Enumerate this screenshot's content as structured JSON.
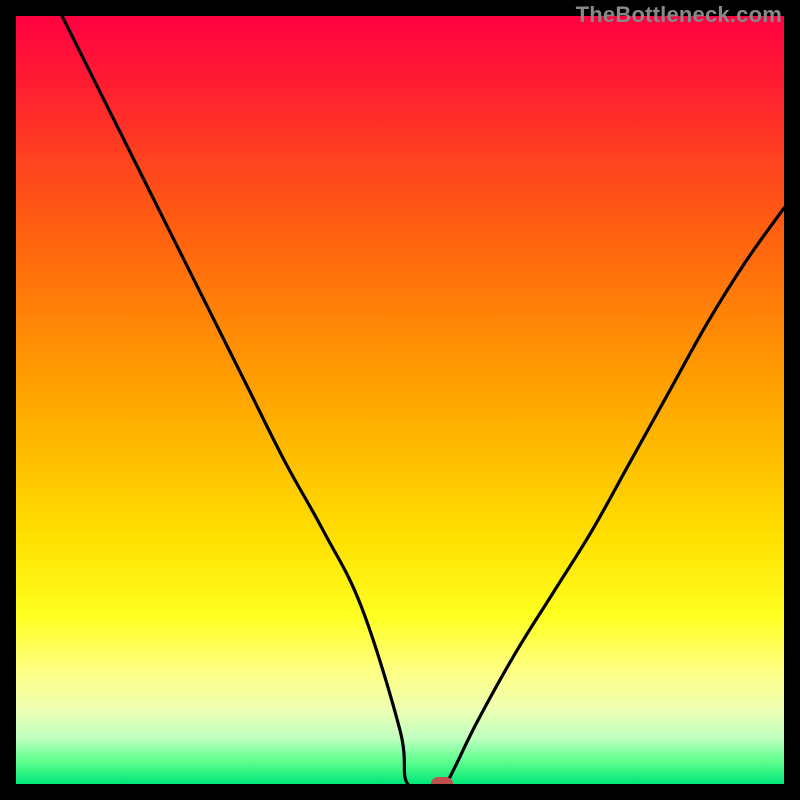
{
  "watermark": "TheBottleneck.com",
  "chart_data": {
    "type": "line",
    "title": "",
    "xlabel": "",
    "ylabel": "",
    "xlim": [
      0,
      100
    ],
    "ylim": [
      0,
      100
    ],
    "background_gradient": {
      "direction": "top-to-bottom",
      "stops": [
        {
          "pos": 0,
          "color": "#ff0040"
        },
        {
          "pos": 50,
          "color": "#ffcc00"
        },
        {
          "pos": 85,
          "color": "#ffff80"
        },
        {
          "pos": 100,
          "color": "#00e878"
        }
      ]
    },
    "series": [
      {
        "name": "bottleneck-curve",
        "x": [
          6,
          10,
          15,
          20,
          25,
          30,
          35,
          40,
          45,
          50,
          51,
          55,
          56,
          60,
          65,
          70,
          75,
          80,
          85,
          90,
          95,
          100
        ],
        "y": [
          100,
          92,
          82,
          72,
          62,
          52,
          42,
          33,
          23,
          7,
          0,
          0,
          0,
          8,
          17,
          25,
          33,
          42,
          51,
          60,
          68,
          75
        ]
      }
    ],
    "marker": {
      "x": 55.5,
      "y": 0,
      "color": "#c05050"
    }
  }
}
